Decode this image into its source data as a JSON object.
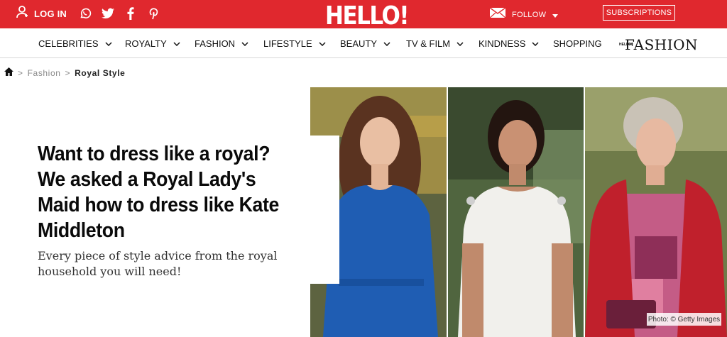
{
  "topbar": {
    "login_label": "LOG IN",
    "logo": "HELLO!",
    "follow_label": "FOLLOW",
    "subscriptions_label": "SUBSCRIPTIONS",
    "social_icons": [
      "whatsapp-icon",
      "twitter-icon",
      "facebook-icon",
      "pinterest-icon"
    ],
    "background_color": "#e0282e"
  },
  "nav": {
    "items": [
      {
        "label": "CELEBRITIES",
        "dropdown": true
      },
      {
        "label": "ROYALTY",
        "dropdown": true
      },
      {
        "label": "FASHION",
        "dropdown": true
      },
      {
        "label": "LIFESTYLE",
        "dropdown": true
      },
      {
        "label": "BEAUTY",
        "dropdown": true
      },
      {
        "label": "TV & FILM",
        "dropdown": true
      },
      {
        "label": "KINDNESS",
        "dropdown": true
      },
      {
        "label": "SHOPPING",
        "dropdown": false
      }
    ],
    "fashion_logo_small": "HELLO!",
    "fashion_logo": "FASHION"
  },
  "breadcrumb": {
    "items": [
      "Fashion",
      "Royal Style"
    ],
    "separator": ">"
  },
  "article": {
    "headline": "Want to dress like a royal? We asked a Royal Lady's Maid how to dress like Kate Middleton",
    "subheadline": "Every piece of style advice from the royal household you will need!",
    "photo_credit": "Photo: © Getty Images"
  }
}
